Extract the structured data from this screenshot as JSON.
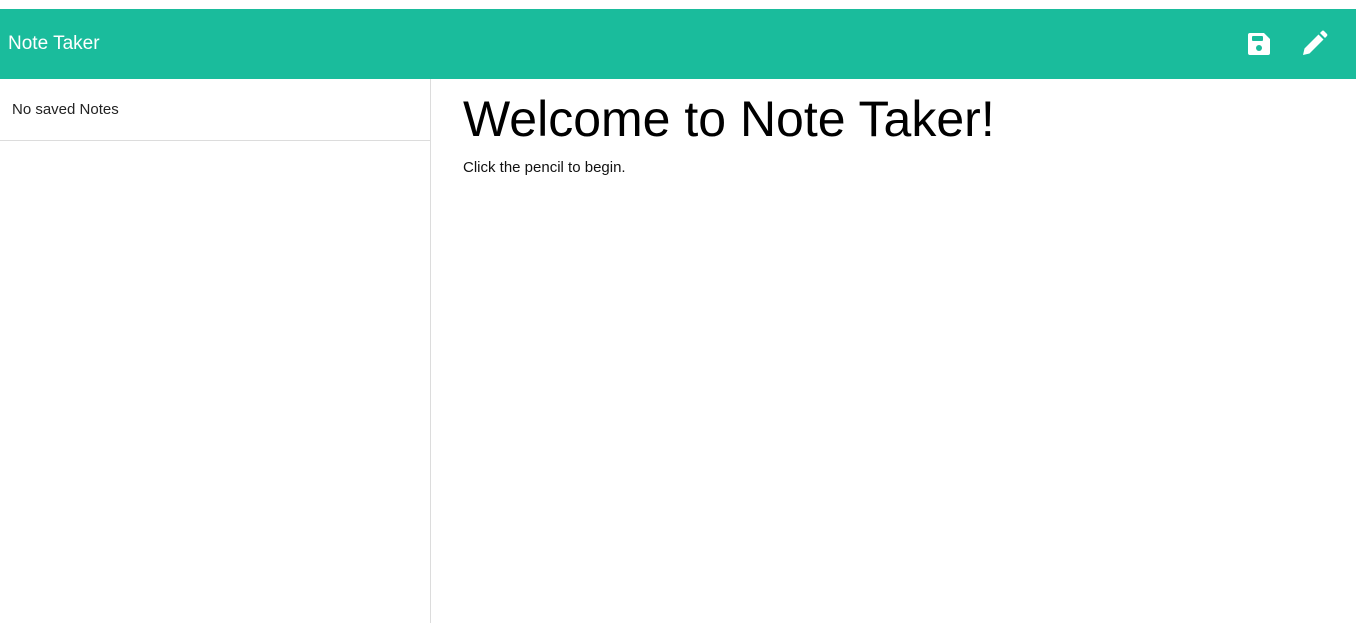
{
  "navbar": {
    "brand": "Note Taker",
    "bg_color": "#1abc9c",
    "icons": [
      "save-icon",
      "pencil-icon"
    ]
  },
  "sidebar": {
    "empty_text": "No saved Notes"
  },
  "main": {
    "title": "Welcome to Note Taker!",
    "subtitle": "Click the pencil to begin."
  }
}
